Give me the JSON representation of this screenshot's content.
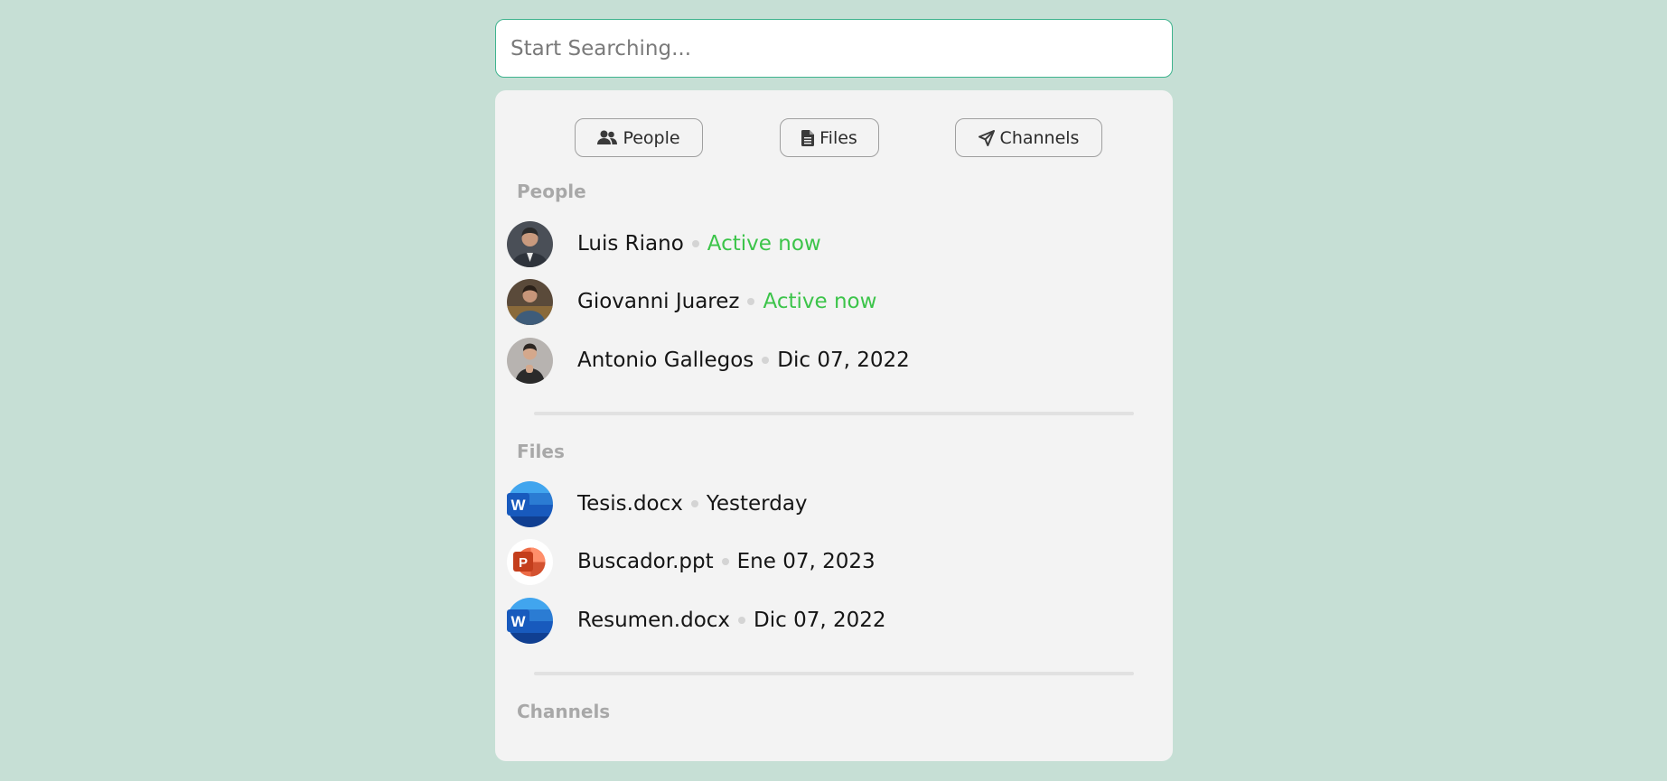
{
  "search": {
    "placeholder": "Start Searching..."
  },
  "filters": {
    "people_label": "People",
    "files_label": "Files",
    "channels_label": "Channels"
  },
  "sections": {
    "people": {
      "title": "People",
      "items": [
        {
          "name": "Luis Riano",
          "meta": "Active now"
        },
        {
          "name": "Giovanni Juarez",
          "meta": "Active now"
        },
        {
          "name": "Antonio Gallegos",
          "meta": "Dic 07, 2022"
        }
      ]
    },
    "files": {
      "title": "Files",
      "items": [
        {
          "name": "Tesis.docx",
          "meta": "Yesterday",
          "icon": "word-icon"
        },
        {
          "name": "Buscador.ppt",
          "meta": "Ene 07, 2023",
          "icon": "powerpoint-icon"
        },
        {
          "name": "Resumen.docx",
          "meta": "Dic 07, 2022",
          "icon": "word-icon"
        }
      ]
    },
    "channels": {
      "title": "Channels"
    }
  },
  "colors": {
    "background": "#c6dfd5",
    "accent": "#3fb38e",
    "active_status": "#3cc44a",
    "panel": "#f3f3f3"
  }
}
